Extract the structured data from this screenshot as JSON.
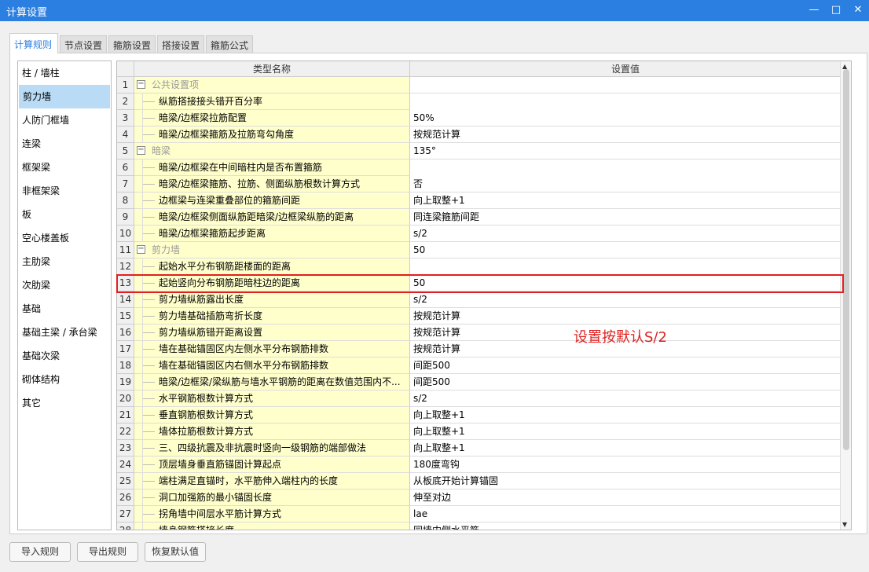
{
  "window": {
    "title": "计算设置",
    "minimize_icon": "minimize-icon",
    "maximize_icon": "maximize-icon",
    "close_icon": "close-icon"
  },
  "tabs": [
    "计算规则",
    "节点设置",
    "箍筋设置",
    "搭接设置",
    "箍筋公式"
  ],
  "sidebar": {
    "selected": "剪力墙",
    "items": [
      "柱 / 墙柱",
      "剪力墙",
      "人防门框墙",
      "连梁",
      "框架梁",
      "非框架梁",
      "板",
      "空心楼盖板",
      "主肋梁",
      "次肋梁",
      "基础",
      "基础主梁 / 承台梁",
      "基础次梁",
      "砌体结构",
      "其它"
    ]
  },
  "grid": {
    "headers": [
      "类型名称",
      "设置值"
    ],
    "rows": [
      {
        "n": "1",
        "name": "公共设置项",
        "value": "",
        "group": true
      },
      {
        "n": "2",
        "name": "纵筋搭接接头错开百分率",
        "value": "50%"
      },
      {
        "n": "3",
        "name": "暗梁/边框梁拉筋配置",
        "value": "按规范计算"
      },
      {
        "n": "4",
        "name": "暗梁/边框梁箍筋及拉筋弯勾角度",
        "value": "135°"
      },
      {
        "n": "5",
        "name": "暗梁",
        "value": "",
        "group": true
      },
      {
        "n": "6",
        "name": "暗梁/边框梁在中间暗柱内是否布置箍筋",
        "value": "否"
      },
      {
        "n": "7",
        "name": "暗梁/边框梁箍筋、拉筋、侧面纵筋根数计算方式",
        "value": "向上取整+1"
      },
      {
        "n": "8",
        "name": "边框梁与连梁重叠部位的箍筋间距",
        "value": "同连梁箍筋间距"
      },
      {
        "n": "9",
        "name": "暗梁/边框梁侧面纵筋距暗梁/边框梁纵筋的距离",
        "value": "s/2"
      },
      {
        "n": "10",
        "name": "暗梁/边框梁箍筋起步距离",
        "value": "50"
      },
      {
        "n": "11",
        "name": "剪力墙",
        "value": "",
        "group": true
      },
      {
        "n": "12",
        "name": "起始水平分布钢筋距楼面的距离",
        "value": "50"
      },
      {
        "n": "13",
        "name": "起始竖向分布钢筋距暗柱边的距离",
        "value": "s/2"
      },
      {
        "n": "14",
        "name": "剪力墙纵筋露出长度",
        "value": "按规范计算"
      },
      {
        "n": "15",
        "name": "剪力墙基础插筋弯折长度",
        "value": "按规范计算"
      },
      {
        "n": "16",
        "name": "剪力墙纵筋错开距离设置",
        "value": "按规范计算"
      },
      {
        "n": "17",
        "name": "墙在基础锚固区内左侧水平分布钢筋排数",
        "value": "间距500"
      },
      {
        "n": "18",
        "name": "墙在基础锚固区内右侧水平分布钢筋排数",
        "value": "间距500"
      },
      {
        "n": "19",
        "name": "暗梁/边框梁/梁纵筋与墙水平钢筋的距离在数值范围内不...",
        "value": "s/2"
      },
      {
        "n": "20",
        "name": "水平钢筋根数计算方式",
        "value": "向上取整+1"
      },
      {
        "n": "21",
        "name": "垂直钢筋根数计算方式",
        "value": "向上取整+1"
      },
      {
        "n": "22",
        "name": "墙体拉筋根数计算方式",
        "value": "向上取整+1"
      },
      {
        "n": "23",
        "name": "三、四级抗震及非抗震时竖向一级钢筋的端部做法",
        "value": "180度弯钩"
      },
      {
        "n": "24",
        "name": "顶层墙身垂直筋锚固计算起点",
        "value": "从板底开始计算锚固"
      },
      {
        "n": "25",
        "name": "端柱满足直锚时，水平筋伸入端柱内的长度",
        "value": "伸至对边"
      },
      {
        "n": "26",
        "name": "洞口加强筋的最小锚固长度",
        "value": "lae"
      },
      {
        "n": "27",
        "name": "拐角墙中间层水平筋计算方式",
        "value": "同墙内侧水平筋"
      },
      {
        "n": "28",
        "name": "墙身钢筋搭接长度",
        "value": "按平法图集计算"
      }
    ],
    "highlighted_row": "13"
  },
  "annotation": {
    "text": "设置按默认S/2",
    "color": "#e02020"
  },
  "buttons": {
    "import": "导入规则",
    "export": "导出规则",
    "restore": "恢复默认值"
  },
  "colors": {
    "titlebar": "#2b7fe0",
    "selection": "#b9dbf5",
    "name_cell": "#ffffcc"
  }
}
